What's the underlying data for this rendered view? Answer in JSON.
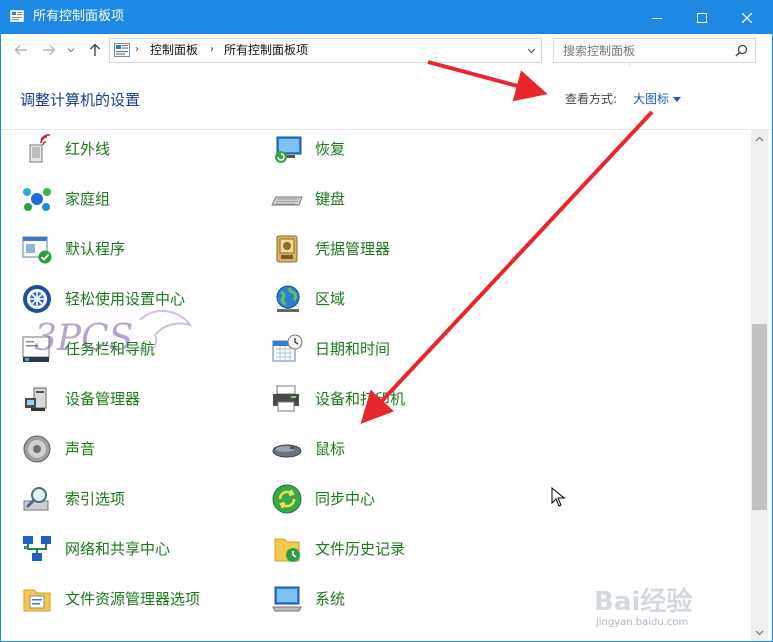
{
  "window": {
    "title": "所有控制面板项",
    "accent": "#1e88e5"
  },
  "address": {
    "breadcrumb": [
      "控制面板",
      "所有控制面板项"
    ],
    "search_placeholder": "搜索控制面板"
  },
  "header": {
    "title": "调整计算机的设置",
    "view_label": "查看方式:",
    "view_value": "大图标"
  },
  "items": {
    "left": [
      {
        "label": "红外线",
        "icon": "infrared-icon"
      },
      {
        "label": "家庭组",
        "icon": "homegroup-icon"
      },
      {
        "label": "默认程序",
        "icon": "default-programs-icon"
      },
      {
        "label": "轻松使用设置中心",
        "icon": "ease-of-access-icon"
      },
      {
        "label": "任务栏和导航",
        "icon": "taskbar-icon"
      },
      {
        "label": "设备管理器",
        "icon": "device-manager-icon"
      },
      {
        "label": "声音",
        "icon": "sound-icon"
      },
      {
        "label": "索引选项",
        "icon": "indexing-icon"
      },
      {
        "label": "网络和共享中心",
        "icon": "network-icon"
      },
      {
        "label": "文件资源管理器选项",
        "icon": "folder-options-icon"
      }
    ],
    "right": [
      {
        "label": "恢复",
        "icon": "recovery-icon"
      },
      {
        "label": "键盘",
        "icon": "keyboard-icon"
      },
      {
        "label": "凭据管理器",
        "icon": "credential-icon"
      },
      {
        "label": "区域",
        "icon": "region-icon"
      },
      {
        "label": "日期和时间",
        "icon": "date-time-icon"
      },
      {
        "label": "设备和打印机",
        "icon": "printer-icon"
      },
      {
        "label": "鼠标",
        "icon": "mouse-icon"
      },
      {
        "label": "同步中心",
        "icon": "sync-icon"
      },
      {
        "label": "文件历史记录",
        "icon": "file-history-icon"
      },
      {
        "label": "系统",
        "icon": "system-icon"
      }
    ]
  },
  "annotations": {
    "arrow_color": "#e8262b",
    "watermark": "3PCS",
    "baidu_logo": "Bai经验",
    "baidu_url": "jingyan.baidu.com"
  }
}
